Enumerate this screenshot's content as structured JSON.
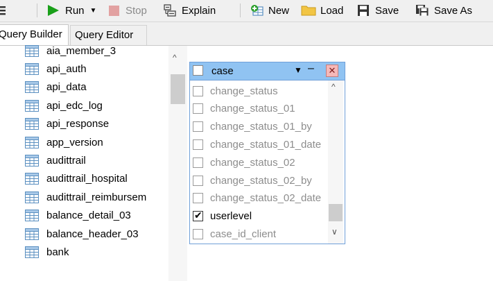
{
  "toolbar": {
    "run_label": "Run",
    "stop_label": "Stop",
    "explain_label": "Explain",
    "new_label": "New",
    "load_label": "Load",
    "save_label": "Save",
    "save_as_label": "Save As"
  },
  "tabs": [
    {
      "label": "Query Builder",
      "active": true
    },
    {
      "label": "Query Editor",
      "active": false
    }
  ],
  "table_list": [
    "aia_member_3",
    "api_auth",
    "api_data",
    "api_edc_log",
    "api_response",
    "app_version",
    "audittrail",
    "audittrail_hospital",
    "audittrail_reimbursem",
    "balance_detail_03",
    "balance_header_03",
    "bank"
  ],
  "table_box": {
    "title": "case",
    "fields": [
      {
        "name": "change_status",
        "checked": false
      },
      {
        "name": "change_status_01",
        "checked": false
      },
      {
        "name": "change_status_01_by",
        "checked": false
      },
      {
        "name": "change_status_01_date",
        "checked": false
      },
      {
        "name": "change_status_02",
        "checked": false
      },
      {
        "name": "change_status_02_by",
        "checked": false
      },
      {
        "name": "change_status_02_date",
        "checked": false
      },
      {
        "name": "userlevel",
        "checked": true
      },
      {
        "name": "case_id_client",
        "checked": false
      }
    ]
  },
  "colors": {
    "run_green": "#1aa01a",
    "header_blue": "#90c3f2",
    "folder_yellow": "#f2c544"
  }
}
